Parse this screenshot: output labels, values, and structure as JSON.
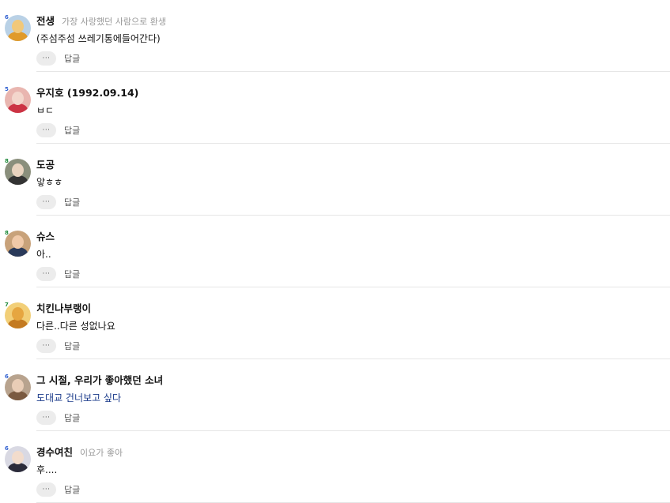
{
  "comments": [
    {
      "level": "6",
      "level_color": "#2f5fd0",
      "nickname": "전생",
      "status_message": "가장 사랑했던 사람으로 환생",
      "text": "(주섬주섬 쓰레기통에들어간다)",
      "text_color": "#111111",
      "avatar_colors": [
        "#f1c87a",
        "#e09a2a",
        "#b9d1e6"
      ],
      "more_label": "···",
      "reply_label": "답글"
    },
    {
      "level": "5",
      "level_color": "#2f5fd0",
      "nickname": "우지호 (1992.09.14)",
      "status_message": "",
      "text": "ㅂㄷ",
      "text_color": "#111111",
      "avatar_colors": [
        "#f3d6cc",
        "#cc3344",
        "#e9b6b0"
      ],
      "more_label": "···",
      "reply_label": "답글"
    },
    {
      "level": "8",
      "level_color": "#1f8a3a",
      "nickname": "도공",
      "status_message": "",
      "text": "앟ㅎㅎ",
      "text_color": "#111111",
      "avatar_colors": [
        "#e8d3bf",
        "#333333",
        "#8a8f7c"
      ],
      "more_label": "···",
      "reply_label": "답글"
    },
    {
      "level": "8",
      "level_color": "#1f8a3a",
      "nickname": "슈스",
      "status_message": "",
      "text": "아..",
      "text_color": "#111111",
      "avatar_colors": [
        "#f0c9a8",
        "#2a3a5a",
        "#c8a27a"
      ],
      "more_label": "···",
      "reply_label": "답글"
    },
    {
      "level": "7",
      "level_color": "#1f8a3a",
      "nickname": "치킨나부랭이",
      "status_message": "",
      "text": "다른..다른 성없나요",
      "text_color": "#111111",
      "avatar_colors": [
        "#e6a640",
        "#c47a20",
        "#f2cf78"
      ],
      "more_label": "···",
      "reply_label": "답글"
    },
    {
      "level": "6",
      "level_color": "#2f5fd0",
      "nickname": "그 시절, 우리가 좋아했던 소녀",
      "status_message": "",
      "text": "도대교 건너보고 싶다",
      "text_color": "#1a3a8a",
      "avatar_colors": [
        "#e9cdb6",
        "#7a5a40",
        "#b8a38e"
      ],
      "more_label": "···",
      "reply_label": "답글"
    },
    {
      "level": "6",
      "level_color": "#2f5fd0",
      "nickname": "경수여친",
      "status_message": "이요가 좋아",
      "text": "후....",
      "text_color": "#111111",
      "avatar_colors": [
        "#f2dccc",
        "#2b2b3a",
        "#d9d9e3"
      ],
      "more_label": "···",
      "reply_label": "답글"
    }
  ]
}
